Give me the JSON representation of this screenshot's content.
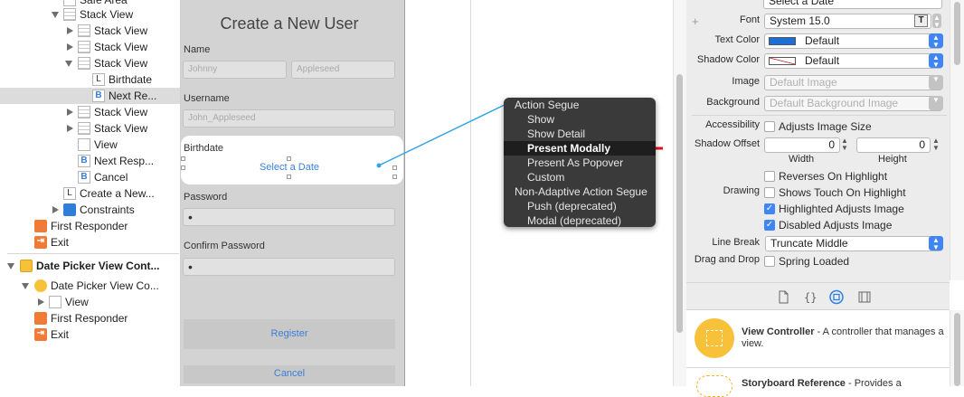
{
  "outline": {
    "items": [
      {
        "label": "Safe Area"
      },
      {
        "label": "Stack View"
      },
      {
        "label": "Stack View"
      },
      {
        "label": "Stack View"
      },
      {
        "label": "Stack View"
      },
      {
        "label": "Birthdate"
      },
      {
        "label": "Next Re..."
      },
      {
        "label": "Stack View"
      },
      {
        "label": "Stack View"
      },
      {
        "label": "View"
      },
      {
        "label": "Next Resp..."
      },
      {
        "label": "Cancel"
      },
      {
        "label": "Create a New..."
      },
      {
        "label": "Constraints"
      },
      {
        "label": "First Responder"
      },
      {
        "label": "Exit"
      },
      {
        "label": "Date Picker View Cont..."
      },
      {
        "label": "Date Picker View Co..."
      },
      {
        "label": "View"
      },
      {
        "label": "First Responder"
      },
      {
        "label": "Exit"
      }
    ]
  },
  "form": {
    "title": "Create a New User",
    "name_label": "Name",
    "first_placeholder": "Johnny",
    "last_placeholder": "Appleseed",
    "username_label": "Username",
    "username_placeholder": "John_Appleseed",
    "birthdate_label": "Birthdate",
    "birthdate_button": "Select a Date",
    "password_label": "Password",
    "password_value": "•",
    "confirm_label": "Confirm Password",
    "confirm_value": "•",
    "register_button": "Register",
    "cancel_button": "Cancel"
  },
  "segue_menu": {
    "header1": "Action Segue",
    "items1": [
      "Show",
      "Show Detail",
      "Present Modally",
      "Present As Popover",
      "Custom"
    ],
    "header2": "Non-Adaptive Action Segue",
    "items2": [
      "Push (deprecated)",
      "Modal (deprecated)"
    ],
    "highlighted": "Present Modally"
  },
  "inspector": {
    "select_date_value": "Select a Date",
    "font_label": "Font",
    "font_value": "System 15.0",
    "text_color_label": "Text Color",
    "text_color_value": "Default",
    "text_color_swatch": "#1a6fd8",
    "shadow_color_label": "Shadow Color",
    "shadow_color_value": "Default",
    "image_label": "Image",
    "image_placeholder": "Default Image",
    "background_label": "Background",
    "background_placeholder": "Default Background Image",
    "accessibility_label": "Accessibility",
    "adjusts_image_size": "Adjusts Image Size",
    "shadow_offset_label": "Shadow Offset",
    "width_value": "0",
    "height_value": "0",
    "width_label": "Width",
    "height_label": "Height",
    "drawing_label": "Drawing",
    "reverses_on_highlight": "Reverses On Highlight",
    "shows_touch_on_highlight": "Shows Touch On Highlight",
    "highlighted_adjusts_image": "Highlighted Adjusts Image",
    "disabled_adjusts_image": "Disabled Adjusts Image",
    "line_break_label": "Line Break",
    "line_break_value": "Truncate Middle",
    "drag_drop_label": "Drag and Drop",
    "spring_loaded": "Spring Loaded",
    "plus": "+"
  },
  "library": {
    "tabs": [
      "file-icon",
      "braces-icon",
      "object-icon",
      "media-icon"
    ],
    "items": [
      {
        "title": "View Controller",
        "desc": " - A controller that manages a view."
      },
      {
        "title": "Storyboard Reference",
        "desc": " - Provides a"
      }
    ]
  },
  "colors": {
    "accent": "#3e86f5",
    "arrow": "#e0121b",
    "connection": "#35a3e8"
  }
}
